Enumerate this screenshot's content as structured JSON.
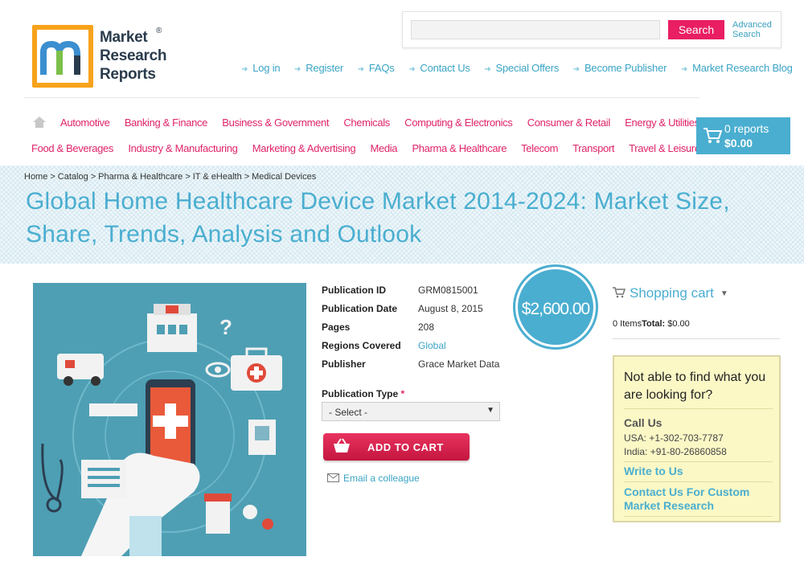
{
  "logo": {
    "lines": [
      "Market",
      "Research",
      "Reports"
    ],
    "reg": "®"
  },
  "search": {
    "placeholder": "",
    "button": "Search",
    "advanced": "Advanced Search"
  },
  "top_nav": [
    "Log in",
    "Register",
    "FAQs",
    "Contact Us",
    "Special Offers",
    "Become Publisher",
    "Market Research Blog"
  ],
  "categories_row1": [
    "Automotive",
    "Banking & Finance",
    "Business & Government",
    "Chemicals",
    "Computing & Electronics",
    "Consumer & Retail",
    "Energy & Utilities"
  ],
  "categories_row2": [
    "Food & Beverages",
    "Industry & Manufacturing",
    "Marketing & Advertising",
    "Media",
    "Pharma & Healthcare",
    "Telecom",
    "Transport",
    "Travel & Leisure"
  ],
  "header_cart": {
    "reports": "0 reports",
    "total": "$0.00"
  },
  "breadcrumb": [
    "Home",
    "Catalog",
    "Pharma & Healthcare",
    "IT & eHealth",
    "Medical Devices"
  ],
  "title": "Global Home Healthcare Device Market 2014-2024: Market Size, Share, Trends, Analysis and Outlook",
  "details": [
    {
      "key": "Publication ID",
      "value": "GRM0815001"
    },
    {
      "key": "Publication Date",
      "value": "August 8, 2015"
    },
    {
      "key": "Pages",
      "value": "208"
    },
    {
      "key": "Regions Covered",
      "value": "Global"
    },
    {
      "key": "Publisher",
      "value": "Grace Market Data"
    }
  ],
  "price": "$2,600.00",
  "publication_type": {
    "label": "Publication Type",
    "required": "*",
    "selected": "- Select -"
  },
  "add_to_cart": "ADD TO CART",
  "email_colleague": "Email a colleague",
  "sidebar": {
    "cart_title": "Shopping cart",
    "items_text": "0 Items",
    "total_label": "Total:",
    "total_value": "$0.00",
    "help_title": "Not able to find what you are looking for?",
    "call_us": "Call Us",
    "phone_usa": "USA: +1-302-703-7787",
    "phone_india": "India: +91-80-26860858",
    "write_to_us": "Write to Us",
    "contact_custom": "Contact Us For Custom Market Research"
  },
  "colors": {
    "brand_blue": "#4aaed0",
    "brand_pink": "#e0246a",
    "cta_red": "#d9234f",
    "help_bg": "#fbf8c6"
  }
}
